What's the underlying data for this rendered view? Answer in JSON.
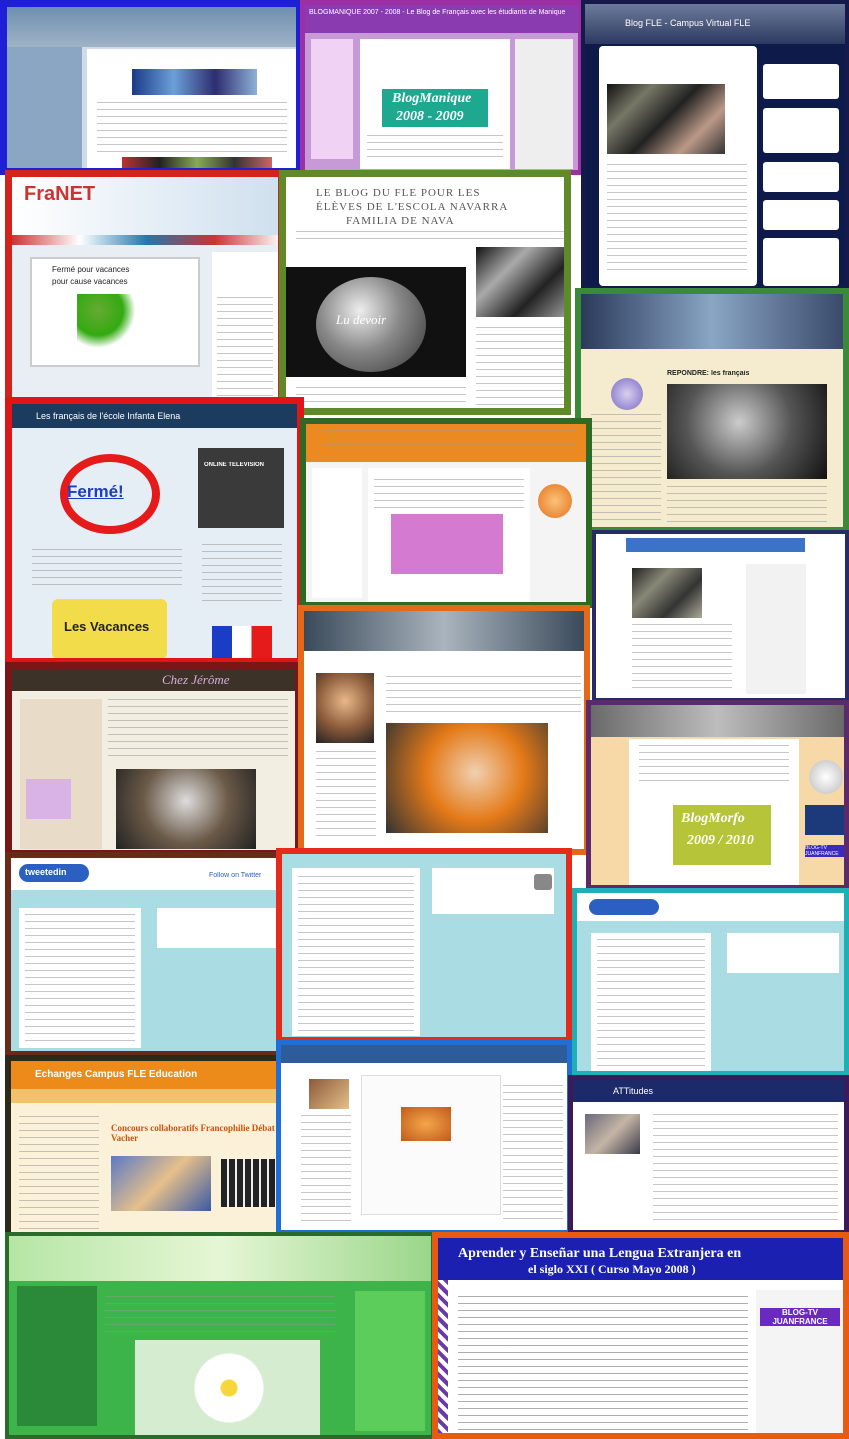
{
  "tiles": {
    "blogmanique": {
      "header": "BLOGMANIQUE 2007 - 2008 - Le Blog de Français avec les étudiants de Manique",
      "logo_line1": "BlogManique",
      "logo_line2": "2008 - 2009"
    },
    "fle_top": {
      "header": "Blog FLE - Campus Virtual FLE"
    },
    "franet": {
      "title": "FraNET",
      "notice_line1": "Fermé pour vacances",
      "notice_line2": "pour cause vacances"
    },
    "pays_basque": {
      "title_line1": "LE BLOG DU FLE POUR LES",
      "title_line2": "ÉLÈVES DE L'ESCOLA NAVARRA",
      "title_line3": "FAMILIA DE NAVA",
      "apple_caption": "Lu devoir"
    },
    "sevres": {
      "caption": "RÉPONDRE: les français"
    },
    "ferme": {
      "title": "Les français de l'école Infanta Elena",
      "stamp": "Fermé!",
      "vacances": "Les Vacances",
      "tv": "ONLINE TELEVISION"
    },
    "chez_jerome": {
      "title": "Chez Jérôme"
    },
    "blogmorfo": {
      "logo_line1": "BlogMorfo",
      "logo_line2": "2009 / 2010",
      "badge": "BLOG-TV JUANFRANCE"
    },
    "tweet": {
      "logo": "tweetedin",
      "follow": "Follow on Twitter"
    },
    "echanges": {
      "title": "Echanges Campus FLE Education",
      "post_title": "Concours collaboratifs Francophilie Débat Vacher"
    },
    "attitudes": {
      "title": "ATTitudes"
    },
    "aprender": {
      "title_line1": "Aprender y Enseñar una Lengua Extranjera en",
      "title_line2": "el siglo XXI ( Curso Mayo 2008 )",
      "badge": "BLOG-TV JUANFRANCE"
    }
  },
  "colors": {
    "frame_red": "#d4221c",
    "frame_blue": "#1f1fd6",
    "frame_green": "#3a7a2a",
    "frame_orange": "#e86612",
    "frame_purple": "#6a1c7a",
    "frame_navy": "#141a4a",
    "twitter_bg": "#a9dde3",
    "green_bg": "#3cb44a"
  }
}
